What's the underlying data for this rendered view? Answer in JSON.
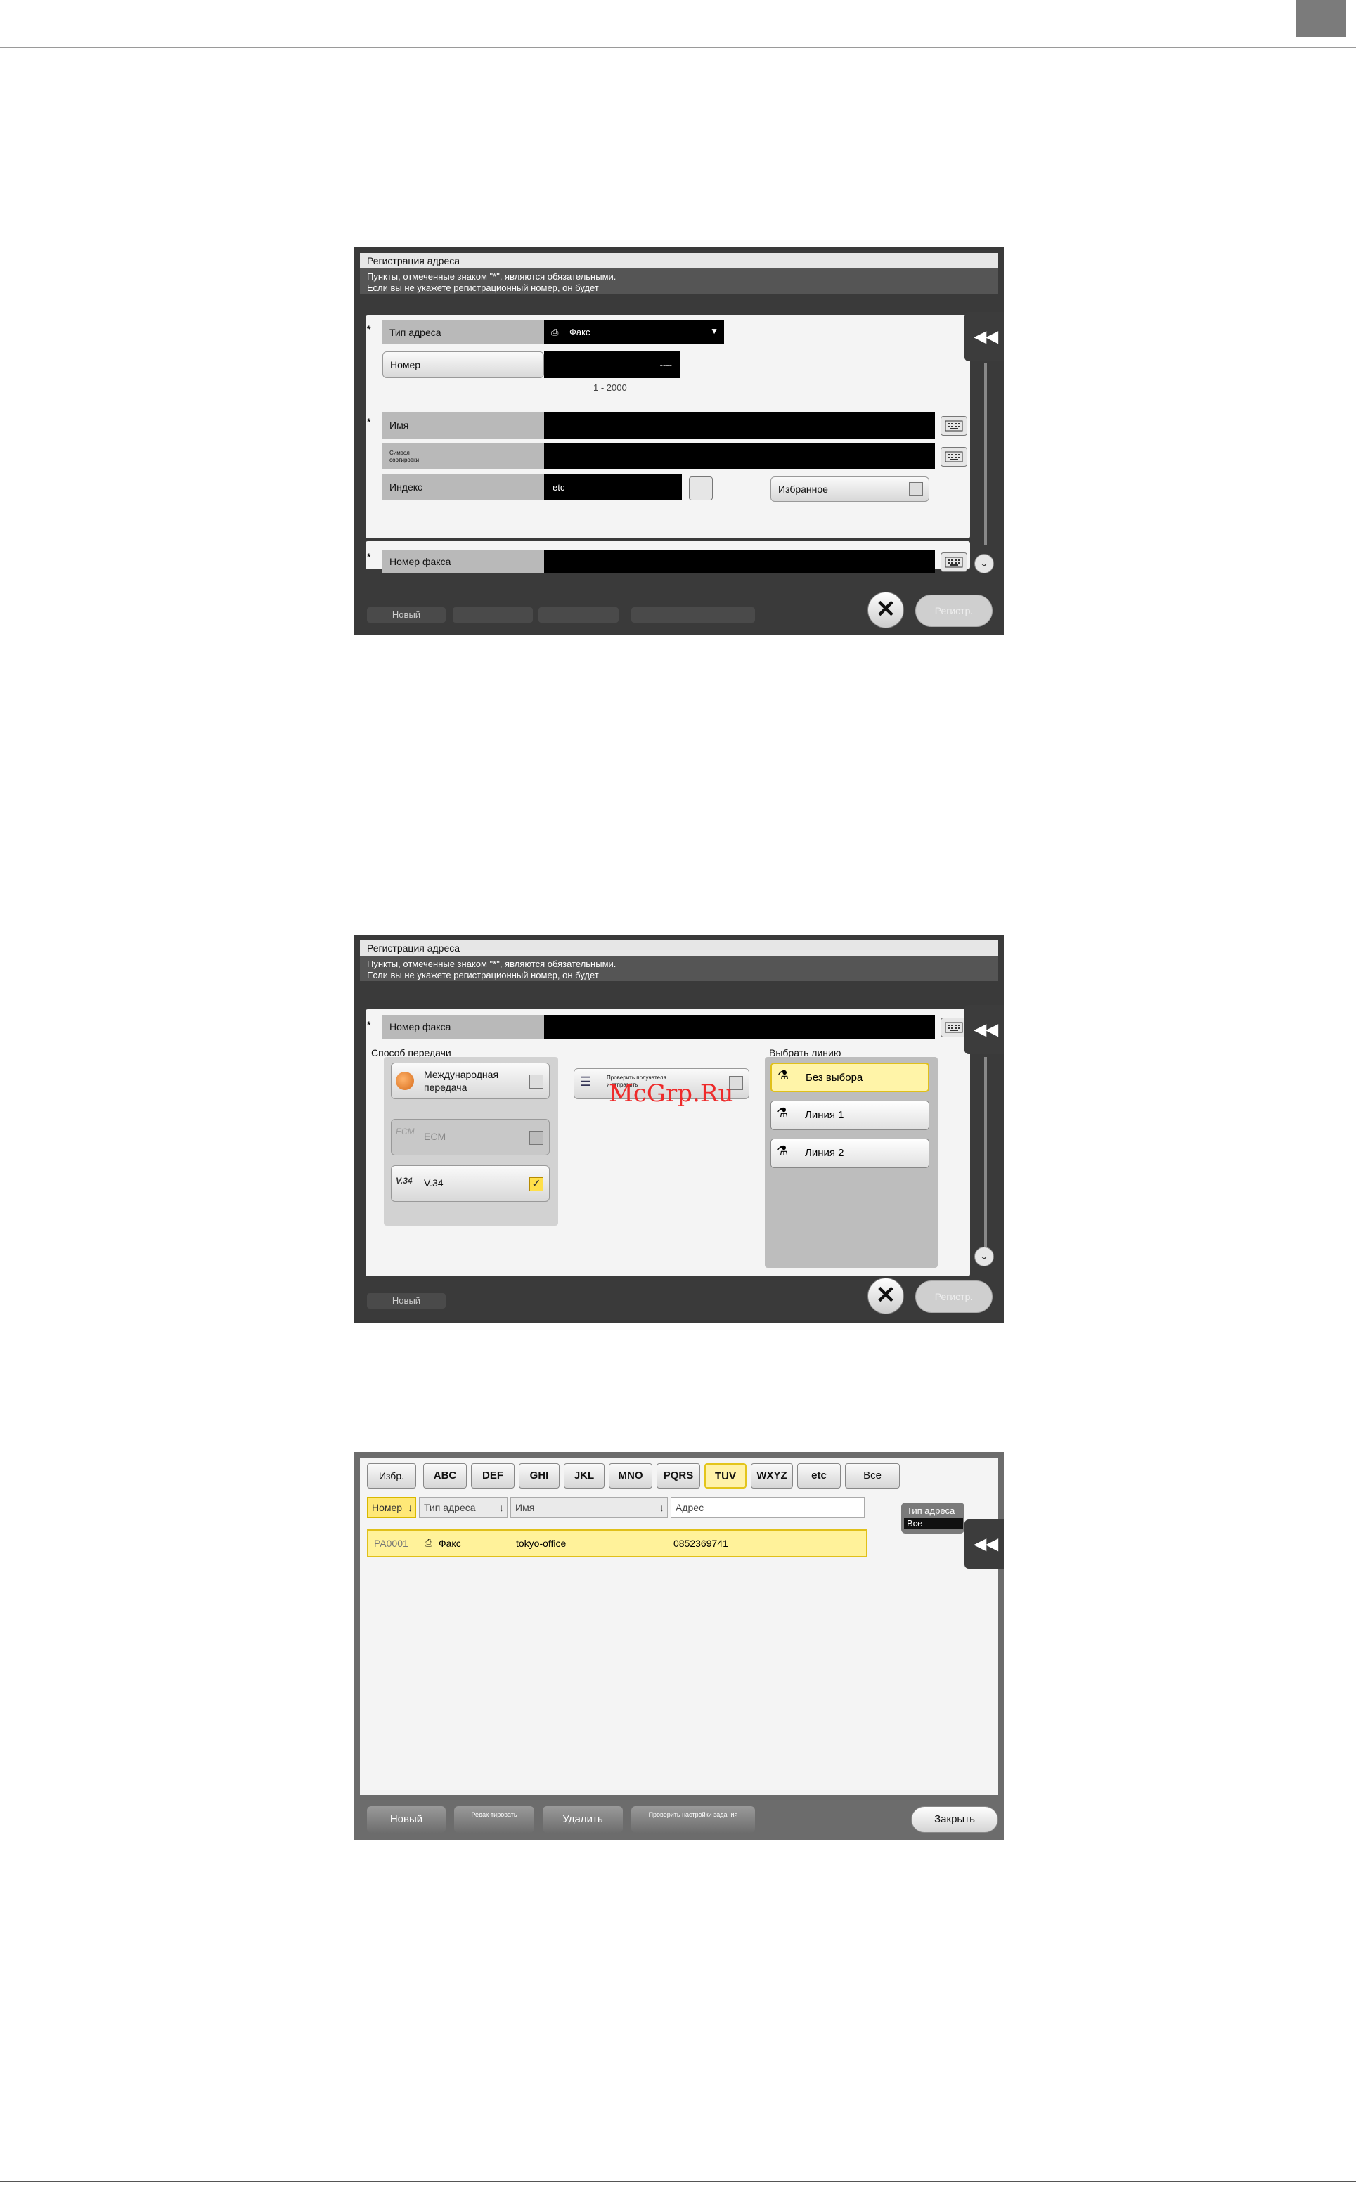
{
  "panel1": {
    "title": "Регистрация адреса",
    "subtitle_line1": "Пункты, отмеченные знаком \"*\", являются обязательными.",
    "subtitle_line2": "Если вы не укажете регистрационный номер, он будет",
    "required_mark": "*",
    "address_type_label": "Тип адреса",
    "address_type_value": "Факс",
    "number_label": "Номер",
    "number_value": "----",
    "number_range": "1 - 2000",
    "name_label": "Имя",
    "sort_label": "Символ сортировки",
    "index_label": "Индекс",
    "index_value": "etc",
    "favorite_label": "Избранное",
    "fax_number_label": "Номер факса",
    "register_label": "Регистр.",
    "new_label": "Новый"
  },
  "panel2": {
    "title": "Регистрация адреса",
    "subtitle_line1": "Пункты, отмеченные знаком \"*\", являются обязательными.",
    "subtitle_line2": "Если вы не укажете регистрационный номер, он будет",
    "required_mark": "*",
    "fax_number_label": "Номер факса",
    "transmission_label": "Способ передачи",
    "intl_label_1": "Международная",
    "intl_label_2": "передача",
    "ecm_label": "ECM",
    "v34_label": "V.34",
    "check_dest_label": "Проверить получателя и отправить",
    "select_line_label": "Выбрать линию",
    "no_select_label": "Без выбора",
    "line1_label": "Линия 1",
    "line2_label": "Линия 2",
    "register_label": "Регистр.",
    "new_label": "Новый"
  },
  "panel3": {
    "tabs": [
      "Избр.",
      "ABC",
      "DEF",
      "GHI",
      "JKL",
      "MNO",
      "PQRS",
      "TUV",
      "WXYZ",
      "etc",
      "Все"
    ],
    "selected_tab": "TUV",
    "columns": {
      "number": "Номер",
      "type": "Тип адреса",
      "name": "Имя",
      "address": "Адрес"
    },
    "row": {
      "number": "PA0001",
      "type": "Факс",
      "name": "tokyo-office",
      "address": "0852369741"
    },
    "address_type_filter_label": "Тип адреса",
    "address_type_filter_value": "Все",
    "new_label": "Новый",
    "edit_label": "Редак-тировать",
    "delete_label": "Удалить",
    "check_job_label": "Проверить настройки задания",
    "close_label": "Закрыть"
  },
  "watermark": "McGrp.Ru"
}
